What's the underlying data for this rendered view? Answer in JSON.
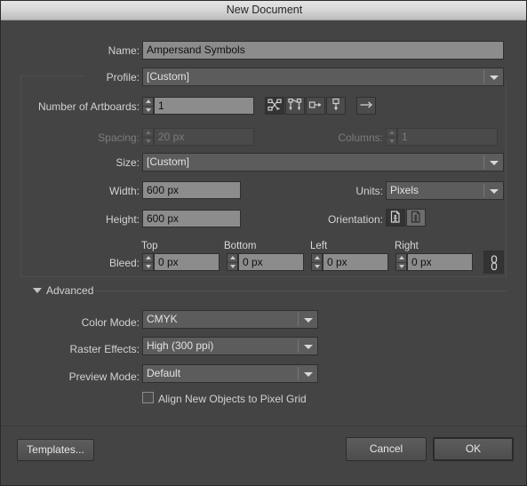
{
  "window": {
    "title": "New Document"
  },
  "form": {
    "name": {
      "label": "Name:",
      "value": "Ampersand Symbols"
    },
    "profile": {
      "label": "Profile:",
      "value": "[Custom]"
    },
    "artboards": {
      "label": "Number of Artboards:",
      "value": "1",
      "arrange_icons": [
        "grid-by-row-icon",
        "grid-by-column-icon",
        "arrange-by-row-icon",
        "arrange-by-column-icon"
      ],
      "direction_icon": "change-to-right-to-left-layout-icon"
    },
    "spacing": {
      "label": "Spacing:",
      "value": "20 px",
      "disabled": true
    },
    "columns": {
      "label": "Columns:",
      "value": "1",
      "disabled": true
    },
    "size": {
      "label": "Size:",
      "value": "[Custom]"
    },
    "width": {
      "label": "Width:",
      "value": "600 px"
    },
    "height": {
      "label": "Height:",
      "value": "600 px"
    },
    "units": {
      "label": "Units:",
      "value": "Pixels"
    },
    "orientation": {
      "label": "Orientation:",
      "portrait_icon": "portrait-orientation-icon",
      "landscape_icon": "landscape-orientation-icon"
    },
    "bleed": {
      "label": "Bleed:",
      "top": {
        "header": "Top",
        "value": "0 px"
      },
      "bottom": {
        "header": "Bottom",
        "value": "0 px"
      },
      "left": {
        "header": "Left",
        "value": "0 px"
      },
      "right": {
        "header": "Right",
        "value": "0 px"
      },
      "link_icon": "link-bleed-values-icon"
    }
  },
  "advanced": {
    "title": "Advanced",
    "color_mode": {
      "label": "Color Mode:",
      "value": "CMYK"
    },
    "raster_effects": {
      "label": "Raster Effects:",
      "value": "High (300 ppi)"
    },
    "preview_mode": {
      "label": "Preview Mode:",
      "value": "Default"
    },
    "align_pixel_grid": {
      "label": "Align New Objects to Pixel Grid",
      "checked": false
    }
  },
  "footer": {
    "templates": "Templates...",
    "cancel": "Cancel",
    "ok": "OK"
  },
  "colors": {
    "dialog_background": "#444444",
    "titlebar_top": "#e4e4e4",
    "titlebar_bottom": "#bdbdbd",
    "field_background": "#8c8c8c",
    "combo_background": "#5c5c5c",
    "label_text": "#d2d2d2",
    "disabled_text": "#7c7c7c"
  }
}
